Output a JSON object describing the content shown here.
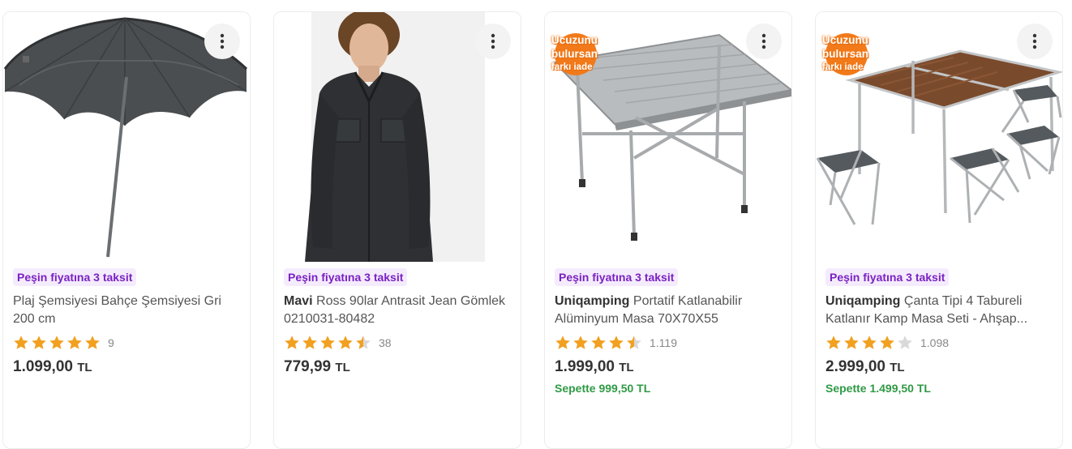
{
  "promo_badge": {
    "line1": "Ucuzunu",
    "line2": "bulursan",
    "line3": "farkı iade"
  },
  "products": [
    {
      "installment": "Peşin fiyatına 3 taksit",
      "brand": "",
      "name": "Plaj Şemsiyesi Bahçe Şemsiyesi Gri 200 cm",
      "rating": 5,
      "review_count": "9",
      "price": "1.099,00",
      "currency": "TL",
      "basket_price": ""
    },
    {
      "installment": "Peşin fiyatına 3 taksit",
      "brand": "Mavi",
      "name": "Ross 90lar Antrasit Jean Gömlek 0210031-80482",
      "rating": 4.5,
      "review_count": "38",
      "price": "779,99",
      "currency": "TL",
      "basket_price": ""
    },
    {
      "installment": "Peşin fiyatına 3 taksit",
      "brand": "Uniqamping",
      "name": "Portatif Katlanabilir Alüminyum Masa 70X70X55",
      "rating": 4.5,
      "review_count": "1.119",
      "price": "1.999,00",
      "currency": "TL",
      "basket_price": "Sepette 999,50 TL"
    },
    {
      "installment": "Peşin fiyatına 3 taksit",
      "brand": "Uniqamping",
      "name": "Çanta Tipi 4 Tabureli Katlanır Kamp Masa Seti - Ahşap...",
      "rating": 4,
      "review_count": "1.098",
      "price": "2.999,00",
      "currency": "TL",
      "basket_price": "Sepette 1.499,50 TL"
    }
  ],
  "colors": {
    "star": "#f2a020",
    "star_empty": "#d9d9d9",
    "installment_text": "#7b22c2",
    "installment_bg": "#f4ecfd",
    "basket": "#2f9a45",
    "promo": "#f27a1a"
  }
}
